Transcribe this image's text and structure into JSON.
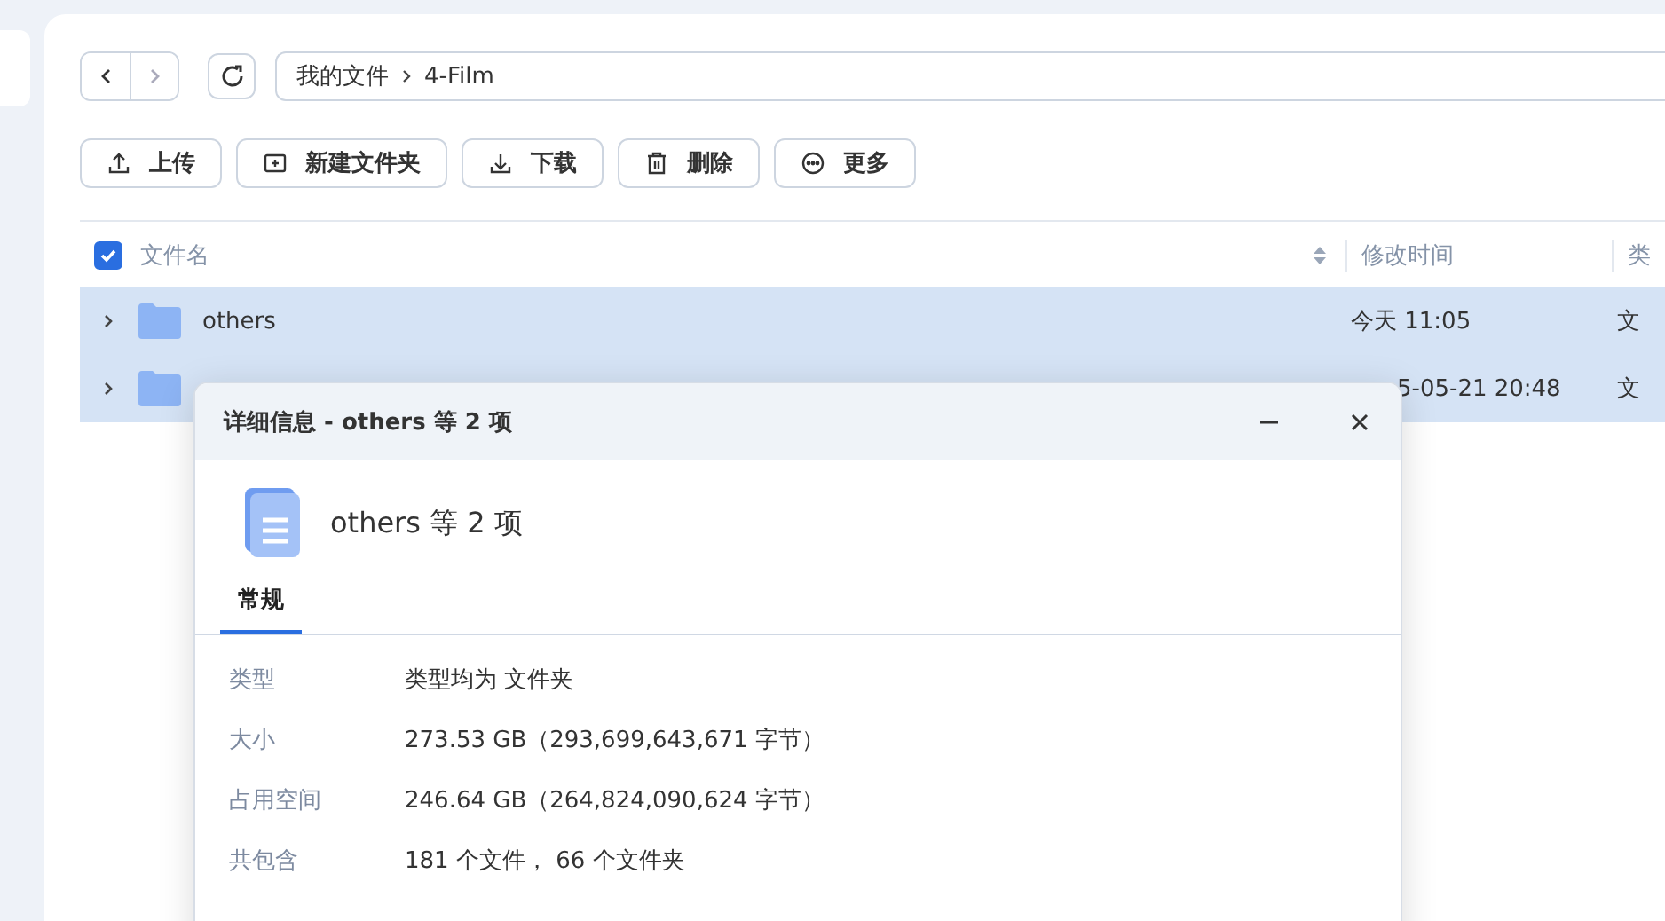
{
  "breadcrumb": [
    "我的文件",
    "4-Film"
  ],
  "toolbar": [
    {
      "label": "上传",
      "kind": "upload"
    },
    {
      "label": "新建文件夹",
      "kind": "new-folder"
    },
    {
      "label": "下载",
      "kind": "download"
    },
    {
      "label": "删除",
      "kind": "delete"
    },
    {
      "label": "更多",
      "kind": "more"
    }
  ],
  "table": {
    "all_checked": true,
    "columns": [
      "文件名",
      "修改时间",
      "类"
    ],
    "rows": [
      {
        "name": "others",
        "modified": "今天 11:05",
        "type": "文",
        "selected": true
      },
      {
        "name": "",
        "modified": "5-05-21 20:48",
        "type": "文",
        "selected": true
      }
    ]
  },
  "dialog": {
    "title": "详细信息 - others 等 2 项",
    "heading": "others 等 2 项",
    "tabs": [
      {
        "label": "常规",
        "selected": true
      }
    ],
    "props": [
      {
        "label": "类型",
        "value": "类型均为 文件夹"
      },
      {
        "label": "大小",
        "value": "273.53 GB（293,699,643,671 字节）"
      },
      {
        "label": "占用空间",
        "value": "246.64 GB（264,824,090,624 字节）"
      },
      {
        "label": "共包含",
        "value": "181 个文件， 66 个文件夹"
      }
    ]
  }
}
